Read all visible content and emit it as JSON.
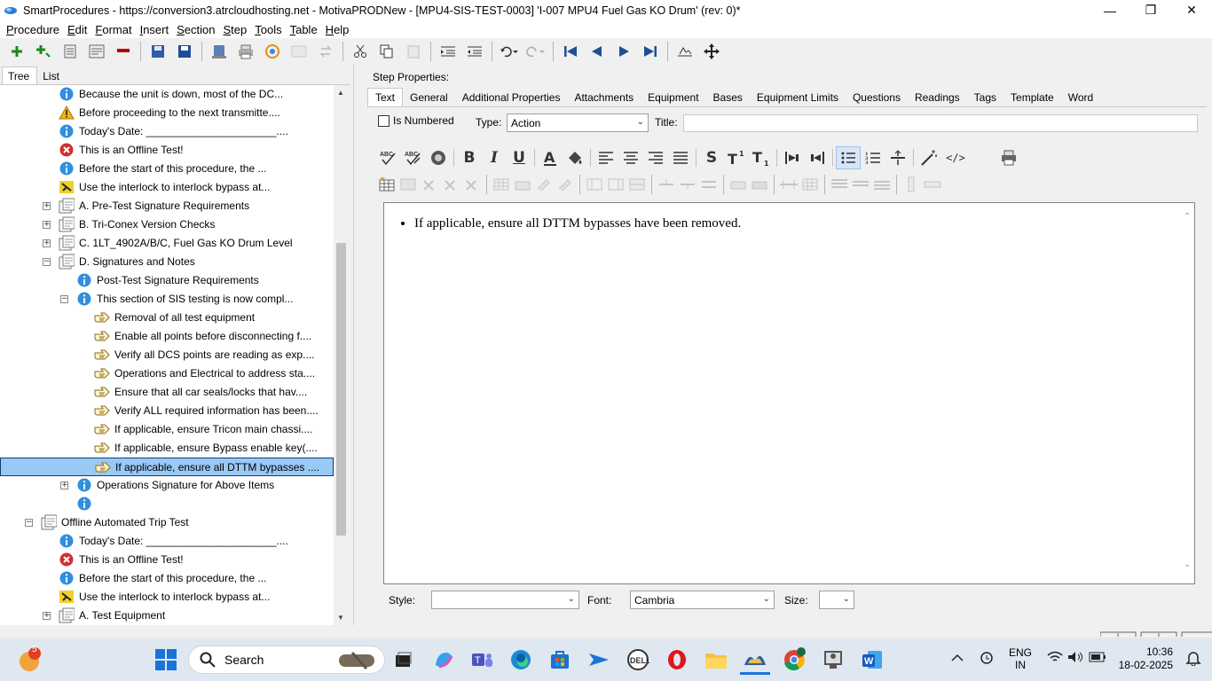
{
  "window": {
    "title": "SmartProcedures - https://conversion3.atrcloudhosting.net - MotivaPRODNew - [MPU4-SIS-TEST-0003] 'I-007 MPU4 Fuel Gas KO Drum' (rev: 0)*",
    "minimize": "—",
    "maximize": "❐",
    "close": "✕"
  },
  "menu": [
    "Procedure",
    "Edit",
    "Format",
    "Insert",
    "Section",
    "Step",
    "Tools",
    "Table",
    "Help"
  ],
  "left_tabs": {
    "tree": "Tree",
    "list": "List"
  },
  "tree": [
    {
      "label": "Because the unit is down, most of the DC...",
      "icon": "info-icon",
      "level": 3
    },
    {
      "label": "Before proceeding to the next transmitte....",
      "icon": "warning-icon",
      "level": 3
    },
    {
      "label": "Today's Date: ______________________....",
      "icon": "info-icon",
      "level": 3
    },
    {
      "label": "This is an Offline Test!",
      "icon": "error-icon",
      "level": 3
    },
    {
      "label": "Before the start of this procedure, the ...",
      "icon": "info-icon",
      "level": 3
    },
    {
      "label": "Use the interlock to interlock bypass at...",
      "icon": "interlock-icon",
      "level": 3
    },
    {
      "label": "A. Pre-Test Signature Requirements",
      "icon": "section-icon",
      "level": 3,
      "expander": "+"
    },
    {
      "label": "B. Tri-Conex Version Checks",
      "icon": "section-icon",
      "level": 3,
      "expander": "+"
    },
    {
      "label": "C. 1LT_4902A/B/C, Fuel Gas KO Drum Level",
      "icon": "section-icon",
      "level": 3,
      "expander": "+"
    },
    {
      "label": "D. Signatures and Notes",
      "icon": "section-icon",
      "level": 3,
      "expander": "−"
    },
    {
      "label": "Post-Test Signature Requirements",
      "icon": "info-icon",
      "level": 4
    },
    {
      "label": "This section of SIS testing is now compl...",
      "icon": "info-icon",
      "level": 4,
      "expander": "−"
    },
    {
      "label": "Removal of all test equipment",
      "icon": "action-icon",
      "level": 5
    },
    {
      "label": "Enable all points before disconnecting f....",
      "icon": "action-icon",
      "level": 5
    },
    {
      "label": "Verify all DCS points are reading as exp....",
      "icon": "action-icon",
      "level": 5
    },
    {
      "label": "Operations and Electrical to address sta....",
      "icon": "action-icon",
      "level": 5
    },
    {
      "label": "Ensure that all car seals/locks that hav....",
      "icon": "action-icon",
      "level": 5
    },
    {
      "label": "Verify ALL required information has been....",
      "icon": "action-icon",
      "level": 5
    },
    {
      "label": "If applicable, ensure Tricon main chassi....",
      "icon": "action-icon",
      "level": 5
    },
    {
      "label": "If applicable, ensure Bypass enable key(....",
      "icon": "action-icon",
      "level": 5
    },
    {
      "label": "If applicable, ensure all DTTM bypasses ....",
      "icon": "action-icon",
      "level": 5,
      "selected": true
    },
    {
      "label": "Operations Signature for Above Items",
      "icon": "info-icon",
      "level": 4,
      "expander": "+"
    },
    {
      "label": "",
      "icon": "info-icon",
      "level": 4
    },
    {
      "label": "Offline Automated Trip Test",
      "icon": "section-icon",
      "level": 2,
      "expander": "−"
    },
    {
      "label": "Today's Date: ______________________....",
      "icon": "info-icon",
      "level": 3
    },
    {
      "label": "This is an Offline Test!",
      "icon": "error-icon",
      "level": 3
    },
    {
      "label": "Before the start of this procedure, the ...",
      "icon": "info-icon",
      "level": 3
    },
    {
      "label": "Use the interlock to interlock bypass at...",
      "icon": "interlock-icon",
      "level": 3
    },
    {
      "label": "A. Test Equipment",
      "icon": "section-icon",
      "level": 3,
      "expander": "+"
    }
  ],
  "step_properties": {
    "heading": "Step Properties:",
    "tabs": [
      "Text",
      "General",
      "Additional Properties",
      "Attachments",
      "Equipment",
      "Bases",
      "Equipment Limits",
      "Questions",
      "Readings",
      "Tags",
      "Template",
      "Word"
    ],
    "is_numbered_label": "Is Numbered",
    "type_label": "Type:",
    "type_value": "Action",
    "title_label": "Title:",
    "title_value": "",
    "editor_text": "If applicable, ensure all DTTM bypasses have been removed.",
    "style_label": "Style:",
    "style_value": "",
    "font_label": "Font:",
    "font_value": "Cambria",
    "size_label": "Size:",
    "size_value": ""
  },
  "taskbar": {
    "search_placeholder": "Search",
    "notification_count": "5",
    "lang_line1": "ENG",
    "lang_line2": "IN",
    "time": "10:36",
    "date": "18-02-2025"
  }
}
